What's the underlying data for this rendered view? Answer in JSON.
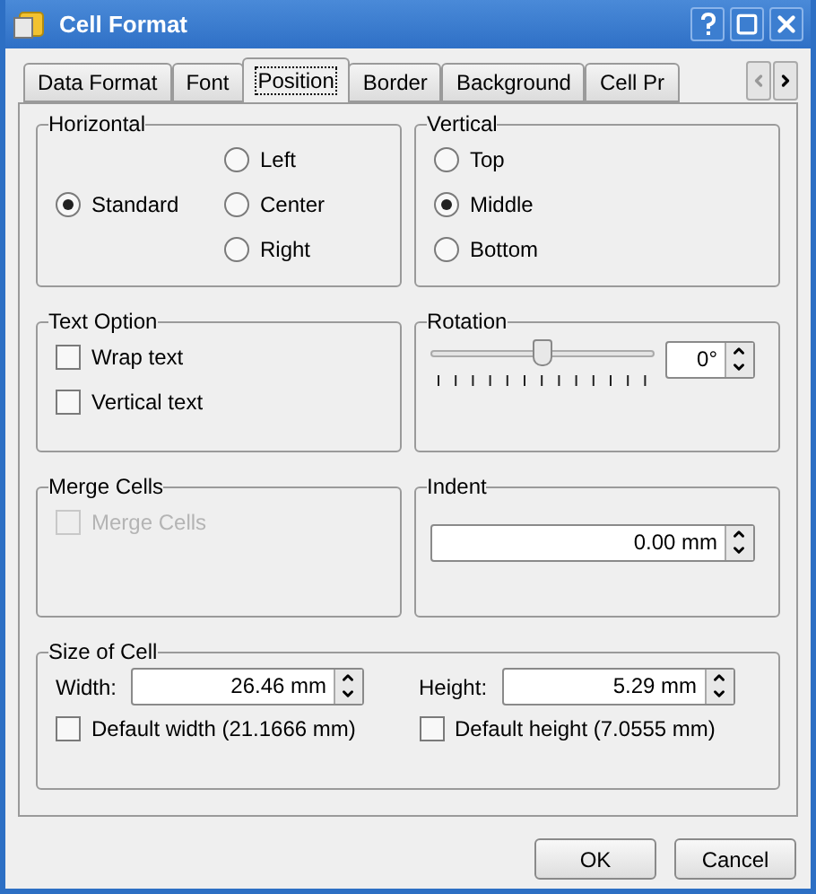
{
  "window": {
    "title": "Cell Format"
  },
  "tabs": [
    {
      "label": "Data Format",
      "selected": false
    },
    {
      "label": "Font",
      "selected": false
    },
    {
      "label": "Position",
      "selected": true
    },
    {
      "label": "Border",
      "selected": false
    },
    {
      "label": "Background",
      "selected": false
    },
    {
      "label": "Cell Pr",
      "selected": false
    }
  ],
  "horizontal": {
    "title": "Horizontal",
    "options": [
      {
        "label": "Standard",
        "selected": true
      },
      {
        "label": "Left",
        "selected": false
      },
      {
        "label": "Center",
        "selected": false
      },
      {
        "label": "Right",
        "selected": false
      }
    ]
  },
  "vertical": {
    "title": "Vertical",
    "options": [
      {
        "label": "Top",
        "selected": false
      },
      {
        "label": "Middle",
        "selected": true
      },
      {
        "label": "Bottom",
        "selected": false
      }
    ]
  },
  "text_option": {
    "title": "Text Option",
    "checkboxes": [
      {
        "label": "Wrap text",
        "checked": false
      },
      {
        "label": "Vertical text",
        "checked": false
      }
    ]
  },
  "rotation": {
    "title": "Rotation",
    "level": 0.5,
    "value": "0°"
  },
  "merge_cells": {
    "title": "Merge Cells",
    "checkbox": {
      "label": "Merge Cells",
      "checked": false,
      "disabled": true
    }
  },
  "indent": {
    "title": "Indent",
    "value": "0.00 mm"
  },
  "size_of_cell": {
    "title": "Size of Cell",
    "width": {
      "label": "Width:",
      "value": "26.46 mm"
    },
    "height": {
      "label": "Height:",
      "value": "5.29 mm"
    },
    "default_width": {
      "label": "Default width (21.1666 mm)",
      "checked": false
    },
    "default_height": {
      "label": "Default height (7.0555 mm)",
      "checked": false
    }
  },
  "buttons": [
    "OK",
    "Cancel"
  ]
}
